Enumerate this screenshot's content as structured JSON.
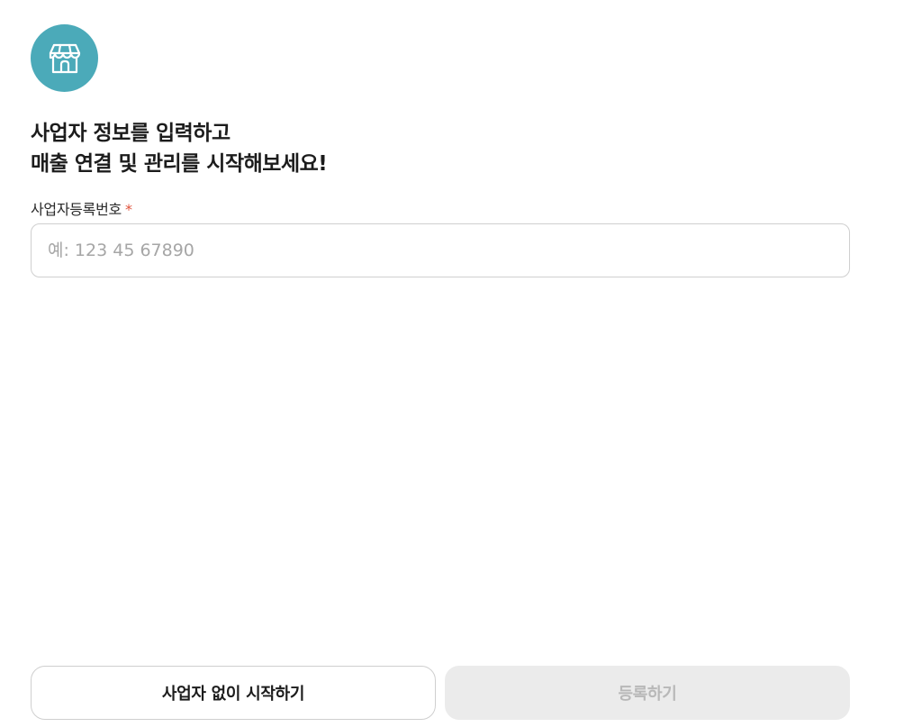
{
  "header": {
    "icon": "store-icon",
    "icon_bg_color": "#4baab9",
    "headline_line1": "사업자 정보를 입력하고",
    "headline_line2": "매출 연결 및 관리를 시작해보세요!"
  },
  "form": {
    "bizno_label": "사업자등록번호",
    "required_mark": "*",
    "bizno_value": "",
    "bizno_placeholder": "예: 123 45 67890"
  },
  "actions": {
    "skip_label": "사업자 없이 시작하기",
    "register_label": "등록하기",
    "register_disabled": true
  },
  "colors": {
    "accent": "#4baab9",
    "required": "#e0533c",
    "disabled_bg": "#ebebeb",
    "disabled_text": "#b8b8b8"
  }
}
